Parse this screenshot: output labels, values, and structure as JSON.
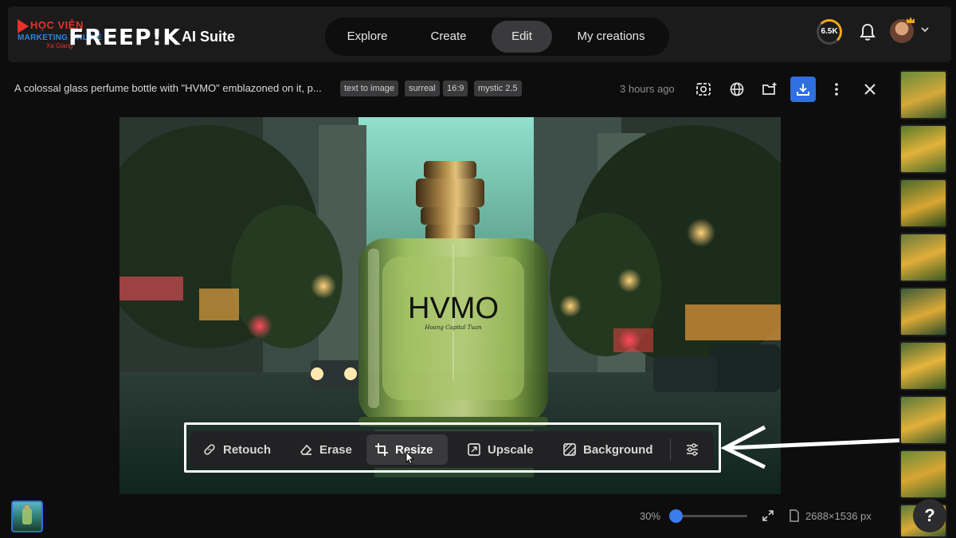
{
  "watermark": {
    "line1": "HỌC VIỆN",
    "line2": "MARKETING ONLINE",
    "line3": "Xa Giang"
  },
  "header": {
    "brand": "FREEP!K",
    "suite": "AI Suite",
    "nav": [
      {
        "label": "Explore"
      },
      {
        "label": "Create"
      },
      {
        "label": "Edit"
      },
      {
        "label": "My creations"
      }
    ],
    "credits": "6.5K",
    "icons": {
      "bell": "bell-icon",
      "avatar": "user-avatar",
      "caret": "chevron-down-icon",
      "crown": "crown-icon"
    }
  },
  "prompt": {
    "text": "A colossal glass perfume bottle with \"HVMO\" emblazoned on it, p...",
    "tags": [
      "text to image",
      "surreal",
      "16:9",
      "mystic 2.5"
    ],
    "time": "3 hours ago"
  },
  "image": {
    "bottle_text": "HVMO",
    "bottle_subtext": "Hoang Capital Tuan"
  },
  "toolbar": {
    "tools": [
      {
        "label": "Retouch",
        "icon": "bandage-icon"
      },
      {
        "label": "Erase",
        "icon": "eraser-icon"
      },
      {
        "label": "Resize",
        "icon": "crop-icon"
      },
      {
        "label": "Upscale",
        "icon": "upscale-icon"
      },
      {
        "label": "Background",
        "icon": "background-icon"
      }
    ],
    "settings_icon": "sliders-icon"
  },
  "footer": {
    "zoom": "30%",
    "zoom_level": 0.3,
    "dimensions": "2688×1536 px",
    "help": "?"
  },
  "colors": {
    "accent": "#2f6fde",
    "credit_ring": "#f0a818",
    "bg": "#0d0d0d"
  }
}
